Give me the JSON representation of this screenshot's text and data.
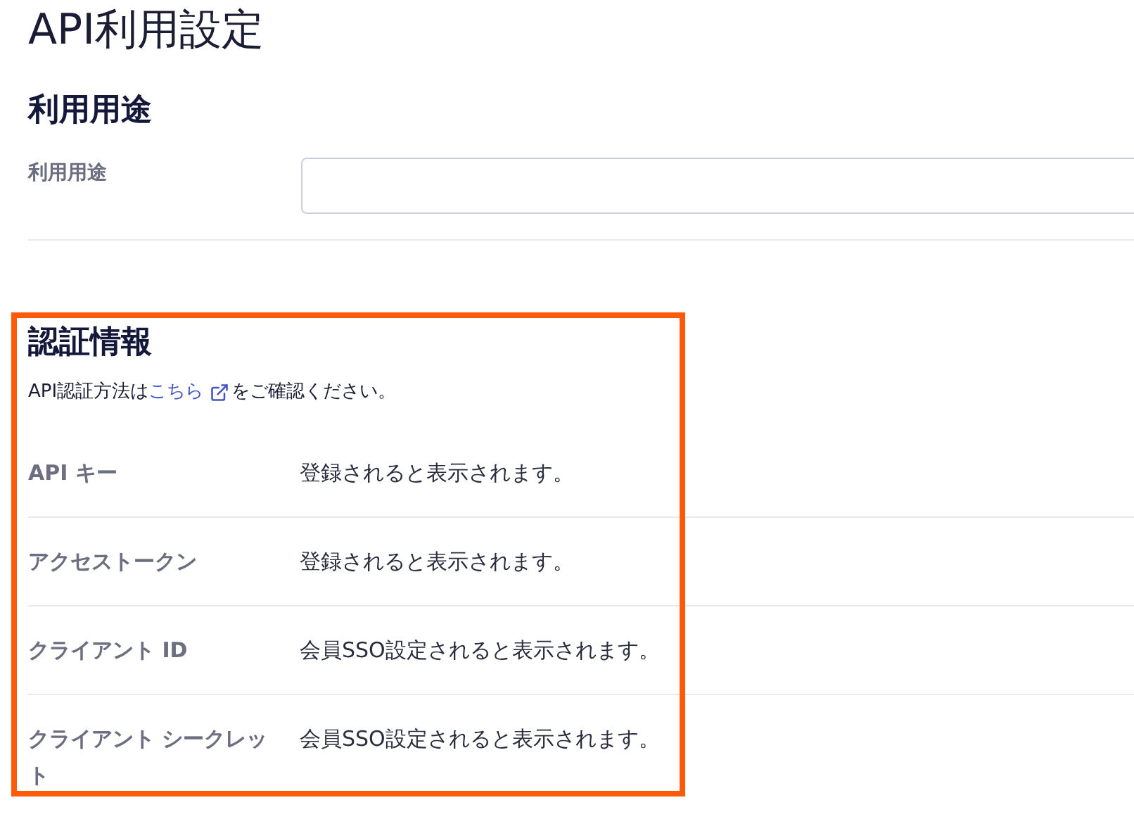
{
  "title": "API利用設定",
  "usage_section": {
    "heading": "利用用途",
    "field": {
      "label": "利用用途"
    }
  },
  "auth_section": {
    "heading": "認証情報",
    "note": {
      "before": "API認証方法は",
      "link": "こちら",
      "after": "をご確認ください。"
    },
    "rows": [
      {
        "label": "API キー",
        "value": "登録されると表示されます。"
      },
      {
        "label": "アクセストークン",
        "value": "登録されると表示されます。"
      },
      {
        "label": "クライアント ID",
        "value": "会員SSO設定されると表示されます。"
      },
      {
        "label": "クライアント シークレット",
        "value": "会員SSO設定されると表示されます。"
      }
    ]
  }
}
